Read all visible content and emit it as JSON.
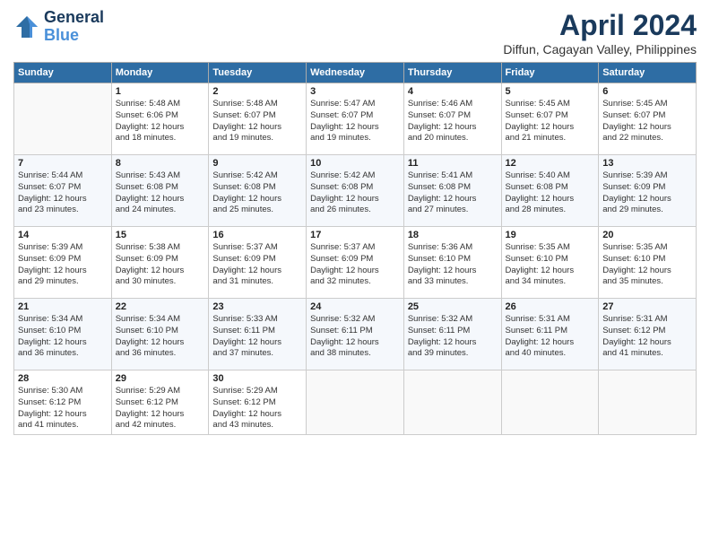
{
  "header": {
    "logo_line1": "General",
    "logo_line2": "Blue",
    "title": "April 2024",
    "subtitle": "Diffun, Cagayan Valley, Philippines"
  },
  "calendar": {
    "headers": [
      "Sunday",
      "Monday",
      "Tuesday",
      "Wednesday",
      "Thursday",
      "Friday",
      "Saturday"
    ],
    "weeks": [
      [
        {
          "day": "",
          "info": ""
        },
        {
          "day": "1",
          "info": "Sunrise: 5:48 AM\nSunset: 6:06 PM\nDaylight: 12 hours\nand 18 minutes."
        },
        {
          "day": "2",
          "info": "Sunrise: 5:48 AM\nSunset: 6:07 PM\nDaylight: 12 hours\nand 19 minutes."
        },
        {
          "day": "3",
          "info": "Sunrise: 5:47 AM\nSunset: 6:07 PM\nDaylight: 12 hours\nand 19 minutes."
        },
        {
          "day": "4",
          "info": "Sunrise: 5:46 AM\nSunset: 6:07 PM\nDaylight: 12 hours\nand 20 minutes."
        },
        {
          "day": "5",
          "info": "Sunrise: 5:45 AM\nSunset: 6:07 PM\nDaylight: 12 hours\nand 21 minutes."
        },
        {
          "day": "6",
          "info": "Sunrise: 5:45 AM\nSunset: 6:07 PM\nDaylight: 12 hours\nand 22 minutes."
        }
      ],
      [
        {
          "day": "7",
          "info": "Sunrise: 5:44 AM\nSunset: 6:07 PM\nDaylight: 12 hours\nand 23 minutes."
        },
        {
          "day": "8",
          "info": "Sunrise: 5:43 AM\nSunset: 6:08 PM\nDaylight: 12 hours\nand 24 minutes."
        },
        {
          "day": "9",
          "info": "Sunrise: 5:42 AM\nSunset: 6:08 PM\nDaylight: 12 hours\nand 25 minutes."
        },
        {
          "day": "10",
          "info": "Sunrise: 5:42 AM\nSunset: 6:08 PM\nDaylight: 12 hours\nand 26 minutes."
        },
        {
          "day": "11",
          "info": "Sunrise: 5:41 AM\nSunset: 6:08 PM\nDaylight: 12 hours\nand 27 minutes."
        },
        {
          "day": "12",
          "info": "Sunrise: 5:40 AM\nSunset: 6:08 PM\nDaylight: 12 hours\nand 28 minutes."
        },
        {
          "day": "13",
          "info": "Sunrise: 5:39 AM\nSunset: 6:09 PM\nDaylight: 12 hours\nand 29 minutes."
        }
      ],
      [
        {
          "day": "14",
          "info": "Sunrise: 5:39 AM\nSunset: 6:09 PM\nDaylight: 12 hours\nand 29 minutes."
        },
        {
          "day": "15",
          "info": "Sunrise: 5:38 AM\nSunset: 6:09 PM\nDaylight: 12 hours\nand 30 minutes."
        },
        {
          "day": "16",
          "info": "Sunrise: 5:37 AM\nSunset: 6:09 PM\nDaylight: 12 hours\nand 31 minutes."
        },
        {
          "day": "17",
          "info": "Sunrise: 5:37 AM\nSunset: 6:09 PM\nDaylight: 12 hours\nand 32 minutes."
        },
        {
          "day": "18",
          "info": "Sunrise: 5:36 AM\nSunset: 6:10 PM\nDaylight: 12 hours\nand 33 minutes."
        },
        {
          "day": "19",
          "info": "Sunrise: 5:35 AM\nSunset: 6:10 PM\nDaylight: 12 hours\nand 34 minutes."
        },
        {
          "day": "20",
          "info": "Sunrise: 5:35 AM\nSunset: 6:10 PM\nDaylight: 12 hours\nand 35 minutes."
        }
      ],
      [
        {
          "day": "21",
          "info": "Sunrise: 5:34 AM\nSunset: 6:10 PM\nDaylight: 12 hours\nand 36 minutes."
        },
        {
          "day": "22",
          "info": "Sunrise: 5:34 AM\nSunset: 6:10 PM\nDaylight: 12 hours\nand 36 minutes."
        },
        {
          "day": "23",
          "info": "Sunrise: 5:33 AM\nSunset: 6:11 PM\nDaylight: 12 hours\nand 37 minutes."
        },
        {
          "day": "24",
          "info": "Sunrise: 5:32 AM\nSunset: 6:11 PM\nDaylight: 12 hours\nand 38 minutes."
        },
        {
          "day": "25",
          "info": "Sunrise: 5:32 AM\nSunset: 6:11 PM\nDaylight: 12 hours\nand 39 minutes."
        },
        {
          "day": "26",
          "info": "Sunrise: 5:31 AM\nSunset: 6:11 PM\nDaylight: 12 hours\nand 40 minutes."
        },
        {
          "day": "27",
          "info": "Sunrise: 5:31 AM\nSunset: 6:12 PM\nDaylight: 12 hours\nand 41 minutes."
        }
      ],
      [
        {
          "day": "28",
          "info": "Sunrise: 5:30 AM\nSunset: 6:12 PM\nDaylight: 12 hours\nand 41 minutes."
        },
        {
          "day": "29",
          "info": "Sunrise: 5:29 AM\nSunset: 6:12 PM\nDaylight: 12 hours\nand 42 minutes."
        },
        {
          "day": "30",
          "info": "Sunrise: 5:29 AM\nSunset: 6:12 PM\nDaylight: 12 hours\nand 43 minutes."
        },
        {
          "day": "",
          "info": ""
        },
        {
          "day": "",
          "info": ""
        },
        {
          "day": "",
          "info": ""
        },
        {
          "day": "",
          "info": ""
        }
      ]
    ]
  }
}
